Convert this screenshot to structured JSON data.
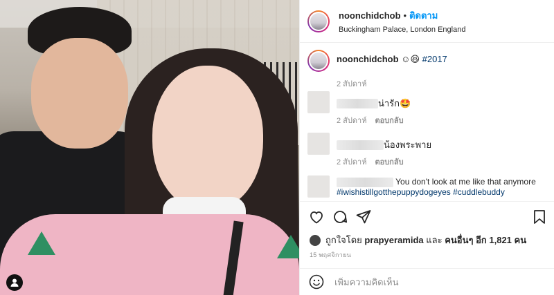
{
  "post": {
    "username": "noonchidchob",
    "follow_label": "ติดตาม",
    "location": "Buckingham Palace, London England",
    "dot": "•"
  },
  "caption": {
    "username": "noonchidchob",
    "emojis": "☺😆",
    "hashtag": "#2017",
    "time": "2 สัปดาห์"
  },
  "comments": [
    {
      "text": "น่ารัก🤩",
      "time": "2 สัปดาห์",
      "reply_label": "ตอบกลับ"
    },
    {
      "text": "น้องพระพาย",
      "time": "2 สัปดาห์",
      "reply_label": "ตอบกลับ"
    },
    {
      "text": "You don't look at me like that anymore",
      "hashtags": "#iwishistillgotthepuppydogeyes #cuddlebuddy"
    }
  ],
  "likes": {
    "prefix": "ถูกใจโดย",
    "user": "prapyeramida",
    "and": "และ",
    "others": "คนอื่นๆ อีก 1,821 คน"
  },
  "date": "15 พฤศจิกายน",
  "add_comment": {
    "placeholder": "เพิ่มความคิดเห็น"
  },
  "icons": [
    "user-tag-icon",
    "heart-icon",
    "comment-icon",
    "share-icon",
    "bookmark-icon",
    "emoji-icon"
  ]
}
